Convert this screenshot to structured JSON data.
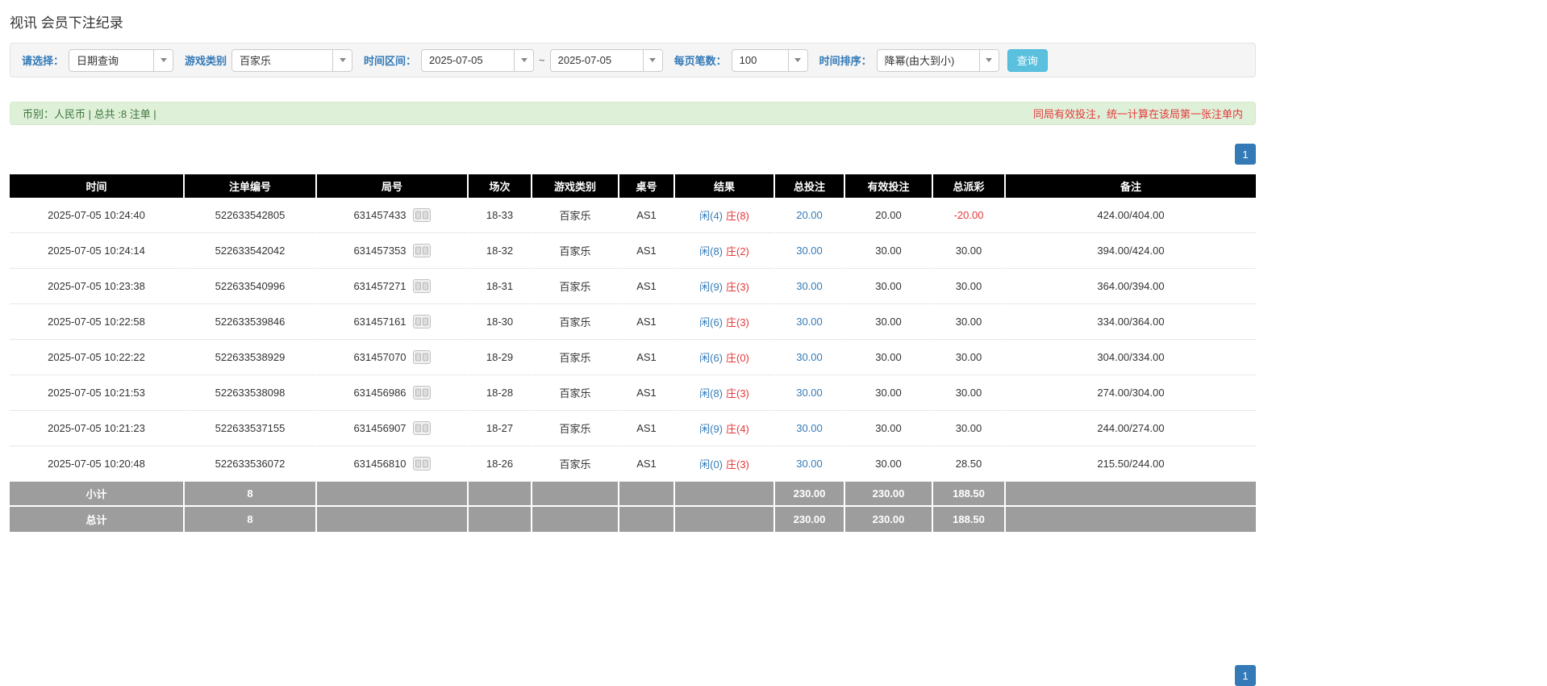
{
  "colors": {
    "accent_blue": "#337ab7",
    "search_button_blue": "#5bc0de",
    "table_header_black": "#000000",
    "table_footer_gray": "#9d9d9d",
    "summary_green_bg": "#dff0d8",
    "summary_green_text": "#3c763d",
    "warning_red": "#e4393c"
  },
  "page": {
    "title": "视讯 会员下注纪录"
  },
  "filters": {
    "select_label": "请选择：",
    "select_value": "日期查询",
    "game_type_label": "游戏类别",
    "game_type_value": "百家乐",
    "time_range_label": "时间区间：",
    "date_from": "2025-07-05",
    "range_separator": "~",
    "date_to": "2025-07-05",
    "page_size_label": "每页笔数：",
    "page_size_value": "100",
    "sort_label": "时间排序：",
    "sort_value": "降幂(由大到小)",
    "search_button_label": "查询"
  },
  "summary": {
    "left_text": "币别：人民币 | 总共 :8 注单 |",
    "right_text": "同局有效投注，统一计算在该局第一张注单内"
  },
  "pagination": {
    "current_page": "1"
  },
  "table": {
    "headers": [
      "时间",
      "注单编号",
      "局号",
      "场次",
      "游戏类别",
      "桌号",
      "结果",
      "总投注",
      "有效投注",
      "总派彩",
      "备注"
    ],
    "rows": [
      {
        "time": "2025-07-05 10:24:40",
        "bet_id": "522633542805",
        "round_id": "631457433",
        "session": "18-33",
        "game": "百家乐",
        "table_no": "AS1",
        "result_player": "闲(4)",
        "result_banker": "庄(8)",
        "total_bet": "20.00",
        "valid_bet": "20.00",
        "payout": "-20.00",
        "remark": "424.00/404.00"
      },
      {
        "time": "2025-07-05 10:24:14",
        "bet_id": "522633542042",
        "round_id": "631457353",
        "session": "18-32",
        "game": "百家乐",
        "table_no": "AS1",
        "result_player": "闲(8)",
        "result_banker": "庄(2)",
        "total_bet": "30.00",
        "valid_bet": "30.00",
        "payout": "30.00",
        "remark": "394.00/424.00"
      },
      {
        "time": "2025-07-05 10:23:38",
        "bet_id": "522633540996",
        "round_id": "631457271",
        "session": "18-31",
        "game": "百家乐",
        "table_no": "AS1",
        "result_player": "闲(9)",
        "result_banker": "庄(3)",
        "total_bet": "30.00",
        "valid_bet": "30.00",
        "payout": "30.00",
        "remark": "364.00/394.00"
      },
      {
        "time": "2025-07-05 10:22:58",
        "bet_id": "522633539846",
        "round_id": "631457161",
        "session": "18-30",
        "game": "百家乐",
        "table_no": "AS1",
        "result_player": "闲(6)",
        "result_banker": "庄(3)",
        "total_bet": "30.00",
        "valid_bet": "30.00",
        "payout": "30.00",
        "remark": "334.00/364.00"
      },
      {
        "time": "2025-07-05 10:22:22",
        "bet_id": "522633538929",
        "round_id": "631457070",
        "session": "18-29",
        "game": "百家乐",
        "table_no": "AS1",
        "result_player": "闲(6)",
        "result_banker": "庄(0)",
        "total_bet": "30.00",
        "valid_bet": "30.00",
        "payout": "30.00",
        "remark": "304.00/334.00"
      },
      {
        "time": "2025-07-05 10:21:53",
        "bet_id": "522633538098",
        "round_id": "631456986",
        "session": "18-28",
        "game": "百家乐",
        "table_no": "AS1",
        "result_player": "闲(8)",
        "result_banker": "庄(3)",
        "total_bet": "30.00",
        "valid_bet": "30.00",
        "payout": "30.00",
        "remark": "274.00/304.00"
      },
      {
        "time": "2025-07-05 10:21:23",
        "bet_id": "522633537155",
        "round_id": "631456907",
        "session": "18-27",
        "game": "百家乐",
        "table_no": "AS1",
        "result_player": "闲(9)",
        "result_banker": "庄(4)",
        "total_bet": "30.00",
        "valid_bet": "30.00",
        "payout": "30.00",
        "remark": "244.00/274.00"
      },
      {
        "time": "2025-07-05 10:20:48",
        "bet_id": "522633536072",
        "round_id": "631456810",
        "session": "18-26",
        "game": "百家乐",
        "table_no": "AS1",
        "result_player": "闲(0)",
        "result_banker": "庄(3)",
        "total_bet": "30.00",
        "valid_bet": "30.00",
        "payout": "28.50",
        "remark": "215.50/244.00"
      }
    ],
    "subtotal": {
      "label": "小计",
      "count": "8",
      "total_bet": "230.00",
      "valid_bet": "230.00",
      "payout": "188.50"
    },
    "grand_total": {
      "label": "总计",
      "count": "8",
      "total_bet": "230.00",
      "valid_bet": "230.00",
      "payout": "188.50"
    }
  }
}
